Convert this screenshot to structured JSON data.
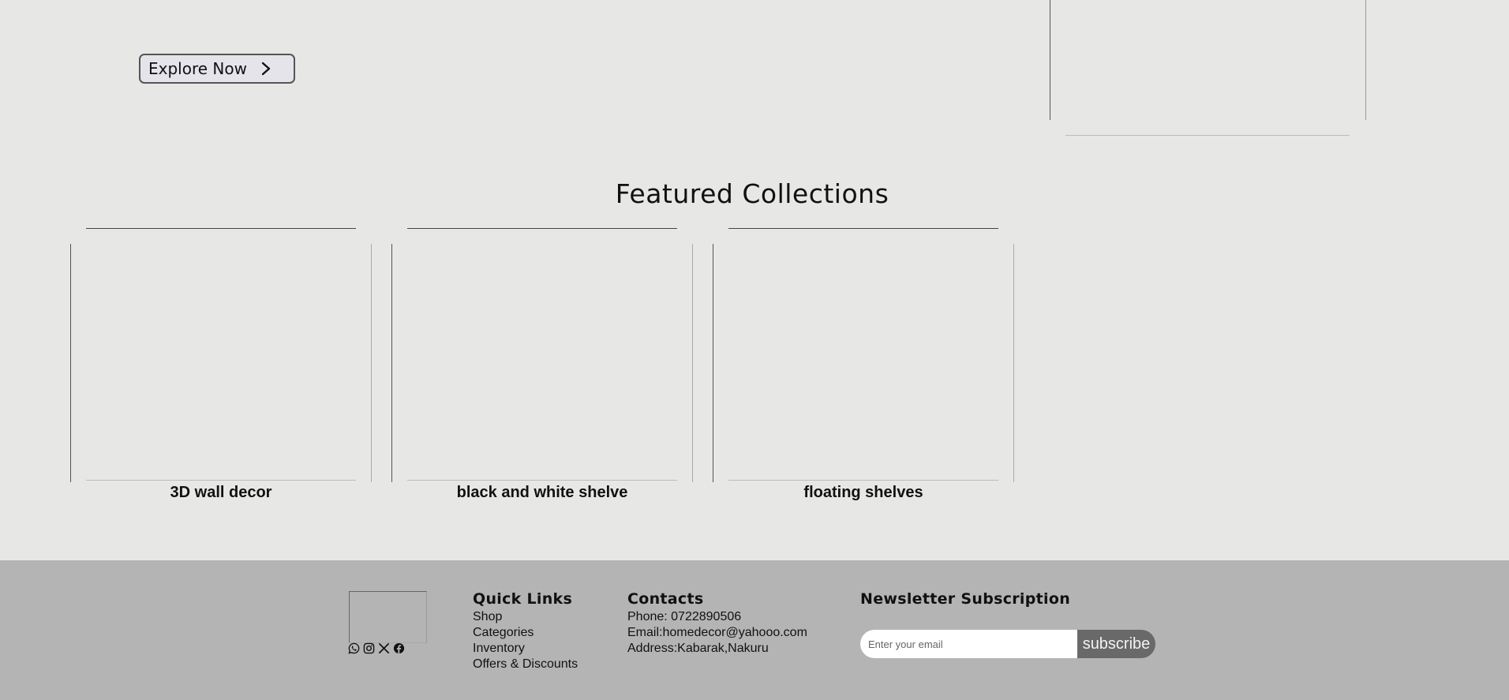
{
  "hero": {
    "explore_label": "Explore Now",
    "explore_icon": "chevron-right-icon"
  },
  "featured": {
    "title": "Featured Collections",
    "cards": [
      {
        "caption": "3D wall decor"
      },
      {
        "caption": "black and white shelve"
      },
      {
        "caption": "floating shelves"
      }
    ]
  },
  "footer": {
    "socials": [
      "whatsapp-icon",
      "instagram-icon",
      "x-icon",
      "facebook-icon"
    ],
    "quick_links": {
      "title": "Quick Links",
      "items": [
        "Shop",
        "Categories",
        "Inventory",
        "Offers & Discounts"
      ]
    },
    "contacts": {
      "title": "Contacts",
      "items": [
        "Phone: 0722890506",
        "Email:homedecor@yahooo.com",
        "Address:Kabarak,Nakuru"
      ]
    },
    "newsletter": {
      "title": "Newsletter Subscription",
      "placeholder": "Enter your email",
      "button_label": "subscribe"
    }
  },
  "colors": {
    "page_background": "#e7e8e6",
    "footer_background": "#b4b4b4",
    "subscribe_button": "#696969"
  }
}
